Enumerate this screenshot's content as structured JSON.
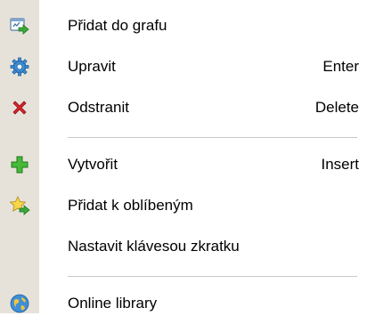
{
  "menu": {
    "items": [
      {
        "label": "Přidat do grafu",
        "shortcut": "",
        "icon": "add-to-chart-icon"
      },
      {
        "label": "Upravit",
        "shortcut": "Enter",
        "icon": "gear-icon"
      },
      {
        "label": "Odstranit",
        "shortcut": "Delete",
        "icon": "delete-x-icon"
      },
      {
        "label": "Vytvořit",
        "shortcut": "Insert",
        "icon": "plus-icon"
      },
      {
        "label": "Přidat k oblíbeným",
        "shortcut": "",
        "icon": "star-add-icon"
      },
      {
        "label": "Nastavit klávesou zkratku",
        "shortcut": "",
        "icon": ""
      },
      {
        "label": "Online library",
        "shortcut": "",
        "icon": "globe-icon"
      }
    ]
  }
}
